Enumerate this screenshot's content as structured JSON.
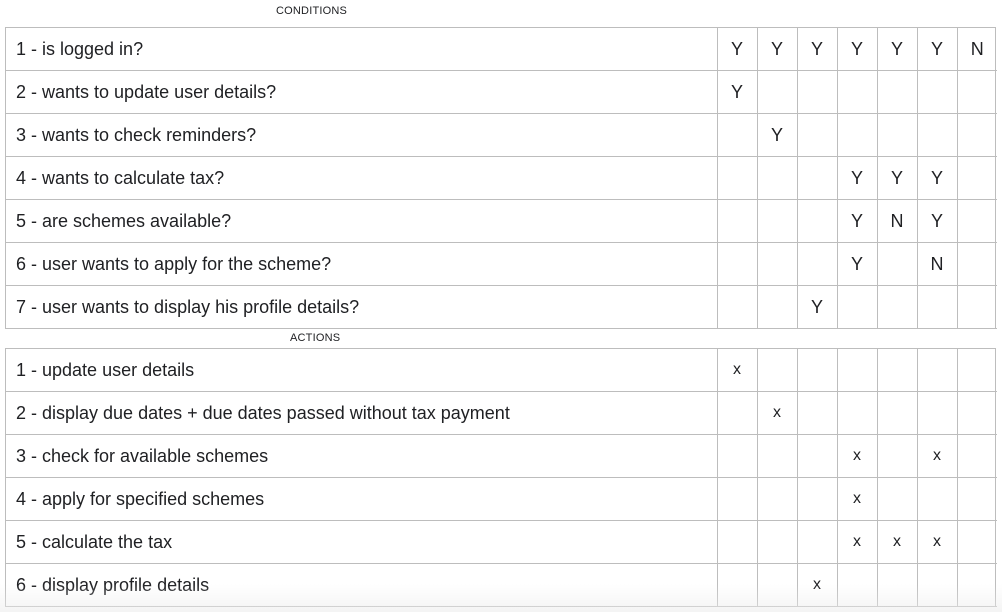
{
  "conditions_label": "CONDITIONS",
  "actions_label": "ACTIONS",
  "conditions": [
    {
      "label": "1 - is logged in?",
      "values": [
        "Y",
        "Y",
        "Y",
        "Y",
        "Y",
        "Y",
        "N"
      ]
    },
    {
      "label": "2 - wants to update user details?",
      "values": [
        "Y",
        "",
        "",
        "",
        "",
        "",
        ""
      ]
    },
    {
      "label": "3 - wants to check reminders?",
      "values": [
        "",
        "Y",
        "",
        "",
        "",
        "",
        ""
      ]
    },
    {
      "label": "4 - wants to calculate tax?",
      "values": [
        "",
        "",
        "",
        "Y",
        "Y",
        "Y",
        ""
      ]
    },
    {
      "label": "5 - are schemes available?",
      "values": [
        "",
        "",
        "",
        "Y",
        "N",
        "Y",
        ""
      ]
    },
    {
      "label": "6 - user wants to apply for the scheme?",
      "values": [
        "",
        "",
        "",
        "Y",
        "",
        "N",
        ""
      ]
    },
    {
      "label": "7 - user wants to display his profile details?",
      "values": [
        "",
        "",
        "Y",
        "",
        "",
        "",
        ""
      ]
    }
  ],
  "actions": [
    {
      "label": "1 - update user details",
      "values": [
        "x",
        "",
        "",
        "",
        "",
        "",
        ""
      ]
    },
    {
      "label": "2 - display due dates + due dates passed without tax payment",
      "values": [
        "",
        "x",
        "",
        "",
        "",
        "",
        ""
      ]
    },
    {
      "label": "3 - check for available schemes",
      "values": [
        "",
        "",
        "",
        "x",
        "",
        "x",
        ""
      ]
    },
    {
      "label": "4 - apply for specified schemes",
      "values": [
        "",
        "",
        "",
        "x",
        "",
        "",
        ""
      ]
    },
    {
      "label": "5 - calculate the tax",
      "values": [
        "",
        "",
        "",
        "x",
        "x",
        "x",
        ""
      ]
    },
    {
      "label": "6 - display profile details",
      "values": [
        "",
        "",
        "x",
        "",
        "",
        "",
        ""
      ]
    }
  ]
}
